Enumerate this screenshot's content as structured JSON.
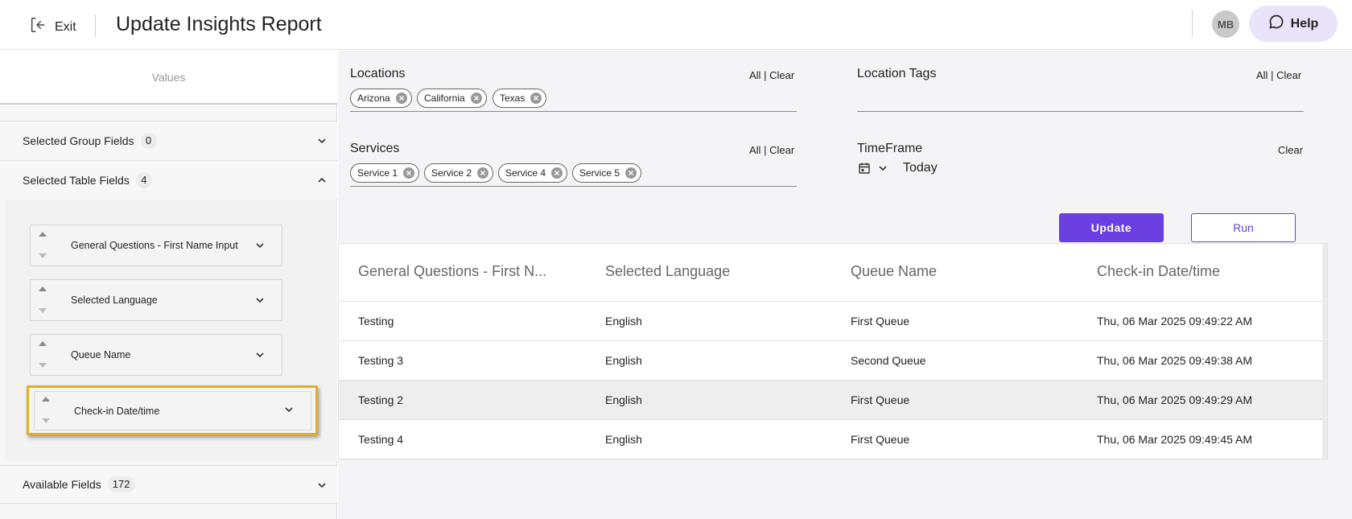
{
  "header": {
    "exit_label": "Exit",
    "title": "Update Insights Report",
    "avatar_initials": "MB",
    "help_label": "Help"
  },
  "sidebar": {
    "values_tab": "Values",
    "group_fields": {
      "label": "Selected Group Fields",
      "count": "0"
    },
    "table_fields": {
      "label": "Selected Table Fields",
      "count": "4",
      "items": [
        {
          "label": "General Questions - First Name Input"
        },
        {
          "label": "Selected Language"
        },
        {
          "label": "Queue Name"
        },
        {
          "label": "Check-in Date/time"
        }
      ]
    },
    "available_fields": {
      "label": "Available Fields",
      "count": "172"
    }
  },
  "filters": {
    "locations": {
      "label": "Locations",
      "all": "All",
      "sep": "|",
      "clear": "Clear",
      "chips": [
        "Arizona",
        "California",
        "Texas"
      ]
    },
    "location_tags": {
      "label": "Location Tags",
      "all": "All",
      "sep": "|",
      "clear": "Clear"
    },
    "services": {
      "label": "Services",
      "all": "All",
      "sep": "|",
      "clear": "Clear",
      "chips": [
        "Service 1",
        "Service 2",
        "Service 4",
        "Service 5"
      ]
    },
    "timeframe": {
      "label": "TimeFrame",
      "clear": "Clear",
      "value": "Today"
    }
  },
  "actions": {
    "update": "Update",
    "run": "Run"
  },
  "table": {
    "columns": [
      "General Questions - First N...",
      "Selected Language",
      "Queue Name",
      "Check-in Date/time"
    ],
    "rows": [
      [
        "Testing",
        "English",
        "First Queue",
        "Thu, 06 Mar 2025 09:49:22 AM"
      ],
      [
        "Testing 3",
        "English",
        "Second Queue",
        "Thu, 06 Mar 2025 09:49:38 AM"
      ],
      [
        "Testing 2",
        "English",
        "First Queue",
        "Thu, 06 Mar 2025 09:49:29 AM"
      ],
      [
        "Testing 4",
        "English",
        "First Queue",
        "Thu, 06 Mar 2025 09:49:45 AM"
      ]
    ]
  },
  "colors": {
    "accent": "#6b3fe0",
    "highlight": "#e6ad1f",
    "help_bg": "#e9e3fb"
  }
}
